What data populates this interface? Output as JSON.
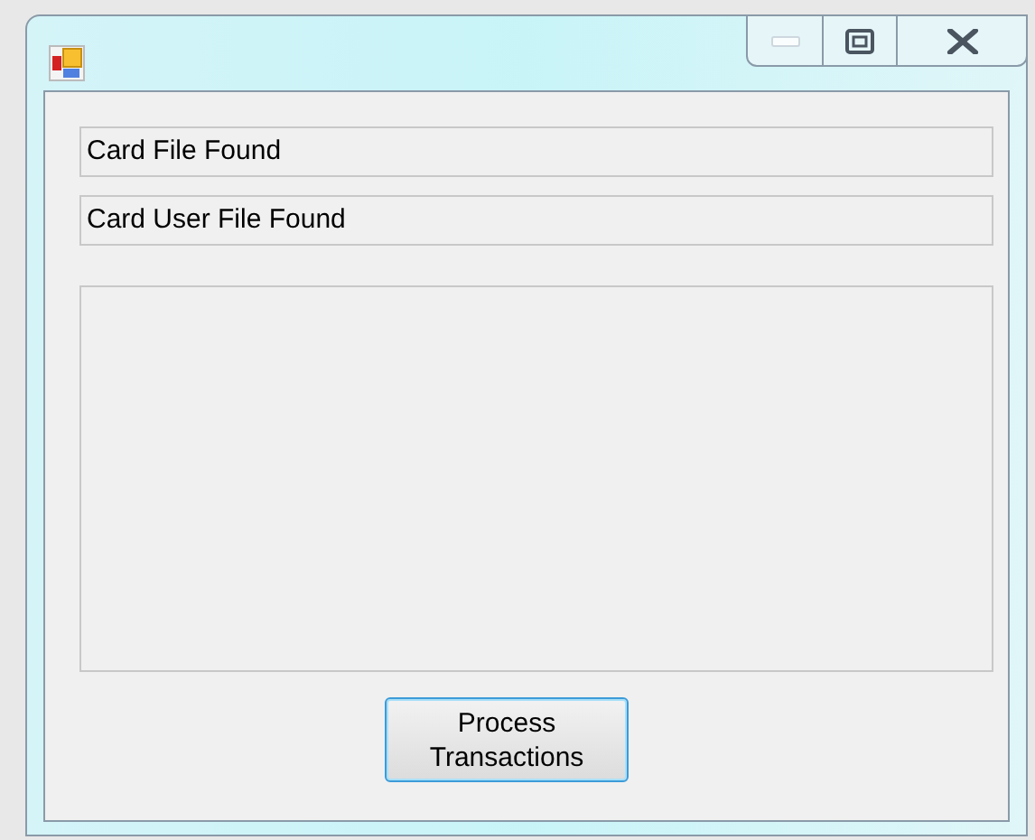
{
  "window": {
    "controls": [
      {
        "kind": "minimize",
        "disabled": true
      },
      {
        "kind": "maximize",
        "disabled": false
      },
      {
        "kind": "close",
        "disabled": false
      }
    ]
  },
  "status_fields": [
    {
      "value": "Card File Found"
    },
    {
      "value": "Card User File Found"
    }
  ],
  "button": {
    "label": "Process\nTransactions"
  }
}
